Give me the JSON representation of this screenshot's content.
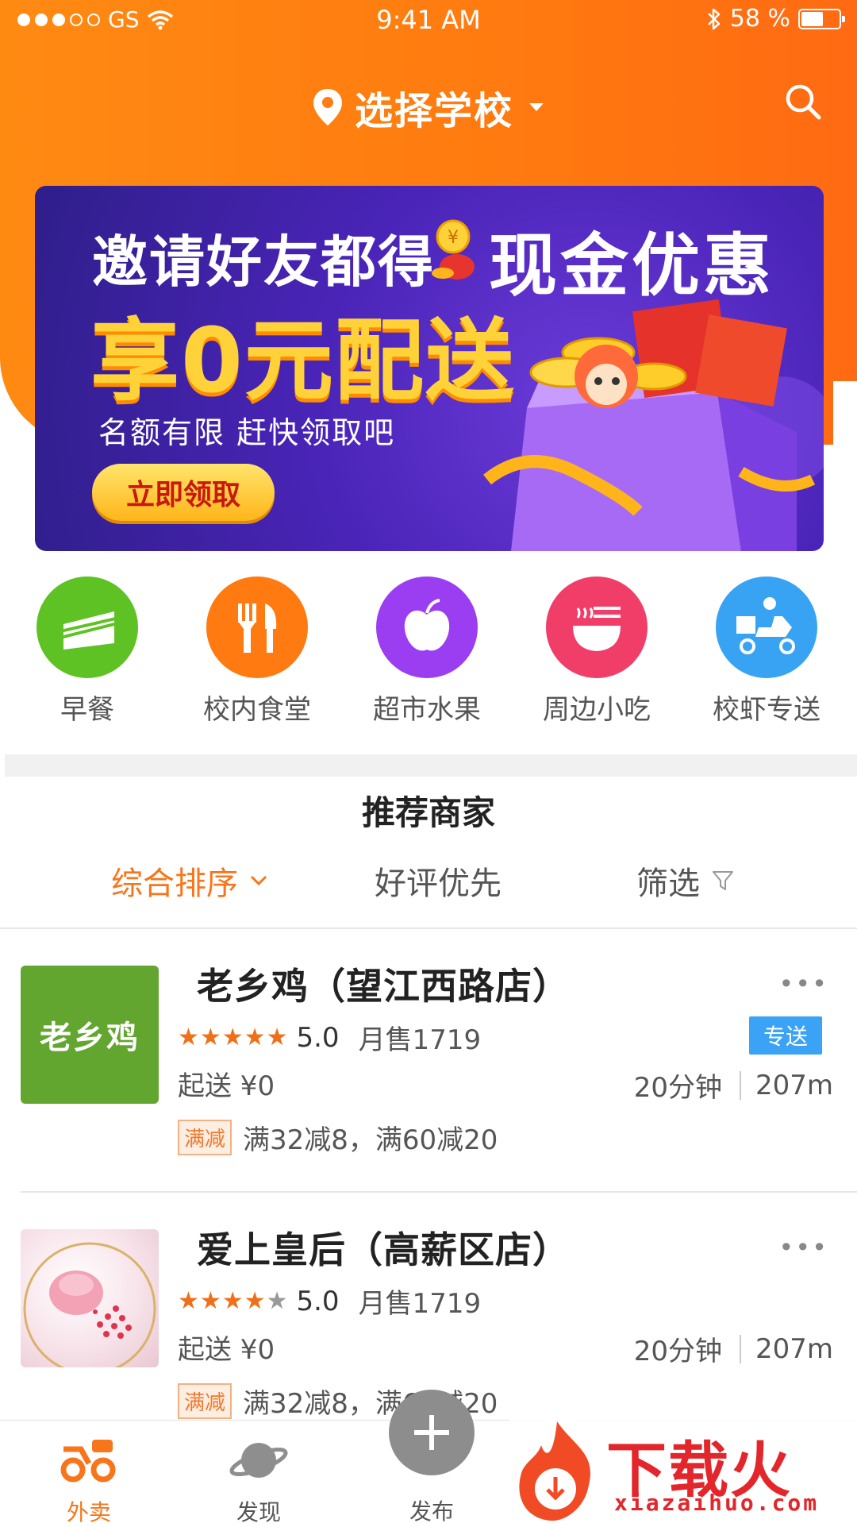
{
  "status_bar": {
    "carrier": "GS",
    "time": "9:41 AM",
    "battery_text": "58 %",
    "battery_level": 0.58
  },
  "header": {
    "title": "选择学校",
    "icons": [
      "location-pin-icon",
      "caret-down-icon",
      "search-icon"
    ]
  },
  "banner": {
    "line1_a": "邀请好友都得",
    "line1_b": "现金优惠",
    "line2": "享0元配送",
    "line3": "名额有限 赶快领取吧",
    "button": "立即领取"
  },
  "categories": [
    {
      "label": "早餐",
      "icon": "cake-icon",
      "color": "#5fc224"
    },
    {
      "label": "校内食堂",
      "icon": "fork-knife-icon",
      "color": "#ff7a10"
    },
    {
      "label": "超市水果",
      "icon": "apple-icon",
      "color": "#9b3df0"
    },
    {
      "label": "周边小吃",
      "icon": "bowl-icon",
      "color": "#f03e68"
    },
    {
      "label": "校虾专送",
      "icon": "scooter-icon",
      "color": "#37a3f2"
    }
  ],
  "recommend": {
    "title": "推荐商家",
    "sort": {
      "comprehensive": "综合排序",
      "rating_first": "好评优先",
      "filter": "筛选"
    }
  },
  "shops": [
    {
      "name": "老乡鸡（望江西路店）",
      "logo_text": "老乡鸡",
      "rating": "5.0",
      "stars": 5,
      "monthly_sales": "月售1719",
      "tag": "专送",
      "min_order": "起送 ¥0",
      "time": "20分钟",
      "distance": "207m",
      "promo_badge": "满减",
      "promo": "满32减8，满60减20"
    },
    {
      "name": "爱上皇后（高薪区店）",
      "logo_text": "",
      "rating": "5.0",
      "stars": 4,
      "monthly_sales": "月售1719",
      "tag": "",
      "min_order": "起送 ¥0",
      "time": "20分钟",
      "distance": "207m",
      "promo_badge": "满减",
      "promo": "满32减8，满60减20"
    }
  ],
  "tabbar": {
    "takeout": "外卖",
    "discover": "发现",
    "publish": "发布"
  },
  "watermark": {
    "text": "下载火",
    "url": "xiazaihuo.com"
  },
  "colors": {
    "brand_orange": "#ff7a10",
    "active_text": "#f7761b",
    "tag_blue": "#3aa3f5"
  }
}
